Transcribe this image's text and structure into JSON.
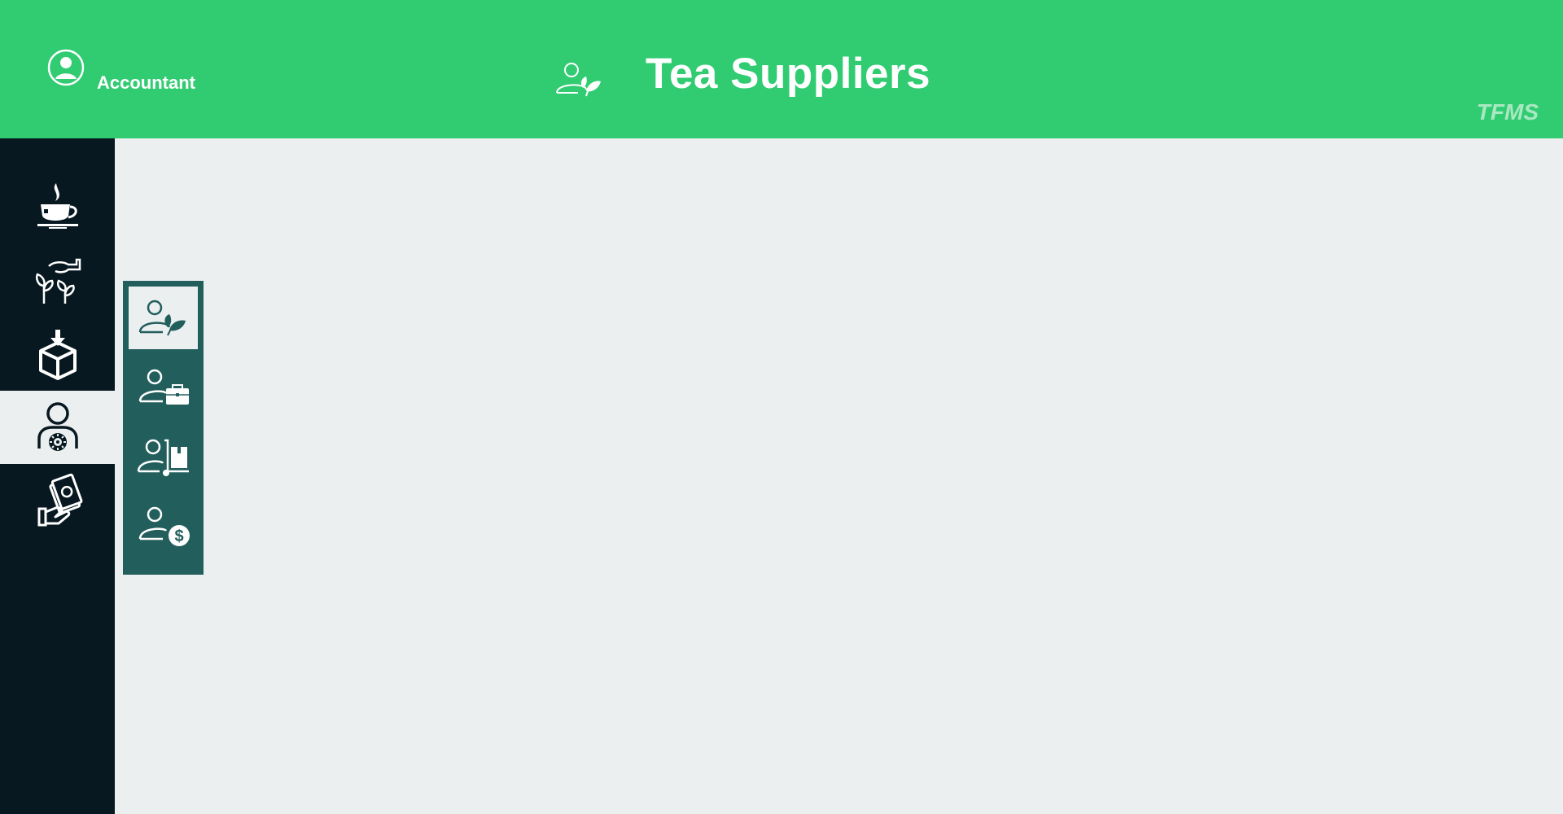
{
  "header": {
    "user_role": "Accountant",
    "title": "Tea Suppliers",
    "brand": "TFMS",
    "title_icon": "tea-supplier-icon",
    "user_icon": "user-circle-icon"
  },
  "sidebar": {
    "active_item": "supplier-management",
    "items": [
      {
        "icon": "tea-cup-icon",
        "name": "tea"
      },
      {
        "icon": "plant-care-icon",
        "name": "plantation"
      },
      {
        "icon": "box-download-icon",
        "name": "inventory"
      },
      {
        "icon": "user-gear-icon",
        "name": "supplier-management"
      },
      {
        "icon": "hand-money-icon",
        "name": "payments"
      }
    ]
  },
  "submenu": {
    "active_item": "tea-suppliers",
    "items": [
      {
        "icon": "user-leaf-icon",
        "name": "tea-suppliers"
      },
      {
        "icon": "user-briefcase-icon",
        "name": "employees"
      },
      {
        "icon": "user-trolley-icon",
        "name": "delivery"
      },
      {
        "icon": "user-dollar-icon",
        "name": "payroll"
      }
    ]
  },
  "colors": {
    "header": "#31cc72",
    "sidebar": "#081820",
    "submenu": "#225f5c",
    "background": "#ebeff0",
    "brand": "#a9e8c1"
  }
}
